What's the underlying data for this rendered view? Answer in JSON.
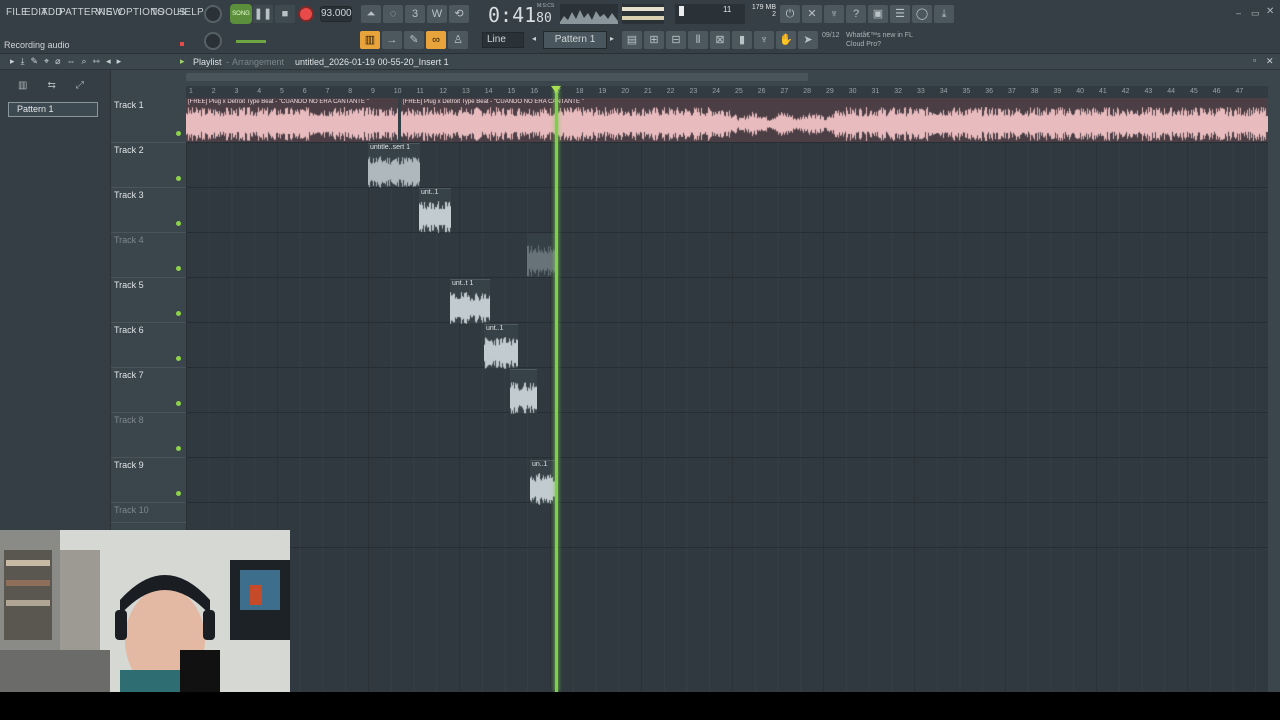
{
  "menu": [
    "FILE",
    "EDIT",
    "ADD",
    "PATTERNS",
    "VIEW",
    "OPTIONS",
    "TOOLS",
    "HELP"
  ],
  "transport": {
    "song_label": "SONG",
    "tempo": "93.000",
    "time": "0:41",
    "time_sub": "80",
    "time_unit": "M:S:CS",
    "cpu": "11",
    "mem": "179 MB",
    "mem_sub": "2"
  },
  "hint": "Recording audio",
  "toolbar2": {
    "snap": "Line",
    "pattern": "Pattern 1",
    "news_date": "09/12",
    "news_text": "Whatâ€™s new in FL Cloud Pro?"
  },
  "playlist": {
    "title": "Playlist",
    "subtitle": "Arrangement",
    "path": "untitled_2026-01-19 00-55-20_Insert 1"
  },
  "patterns": [
    "Pattern 1"
  ],
  "tracks": [
    {
      "name": "Track 1",
      "muted": false
    },
    {
      "name": "Track 2",
      "muted": false
    },
    {
      "name": "Track 3",
      "muted": false
    },
    {
      "name": "Track 4",
      "muted": true
    },
    {
      "name": "Track 5",
      "muted": false
    },
    {
      "name": "Track 6",
      "muted": false
    },
    {
      "name": "Track 7",
      "muted": false
    },
    {
      "name": "Track 8",
      "muted": true
    },
    {
      "name": "Track 9",
      "muted": false
    },
    {
      "name": "Track 10",
      "muted": true
    }
  ],
  "ruler": [
    "1",
    "2",
    "3",
    "4",
    "5",
    "6",
    "7",
    "8",
    "9",
    "10",
    "11",
    "12",
    "13",
    "14",
    "15",
    "16",
    "17",
    "18",
    "19",
    "20",
    "21",
    "22",
    "23",
    "24",
    "25",
    "26",
    "27",
    "28",
    "29",
    "30",
    "31",
    "32",
    "33",
    "34",
    "35",
    "36",
    "37",
    "38",
    "39",
    "40",
    "41",
    "42",
    "43",
    "44",
    "45",
    "46",
    "47"
  ],
  "clips": {
    "main_a": "[FREE] Plug x Detroit Type Beat - \"CUANDO NO ERA CANTANTE \"",
    "main_b": "[FREE] Plug x Detroit Type Beat - \"CUANDO NO ERA CANTANTE \"",
    "t2": "untitle..sert 1",
    "t3": "unt..1",
    "t5": "unt..t 1",
    "t6": "unt..1",
    "t7": "",
    "t9": "un..1"
  },
  "colors": {
    "accent": "#e8a33a",
    "playhead": "#7ed04b",
    "waveform": "#e8bcbf",
    "record": "#e84a4a"
  }
}
